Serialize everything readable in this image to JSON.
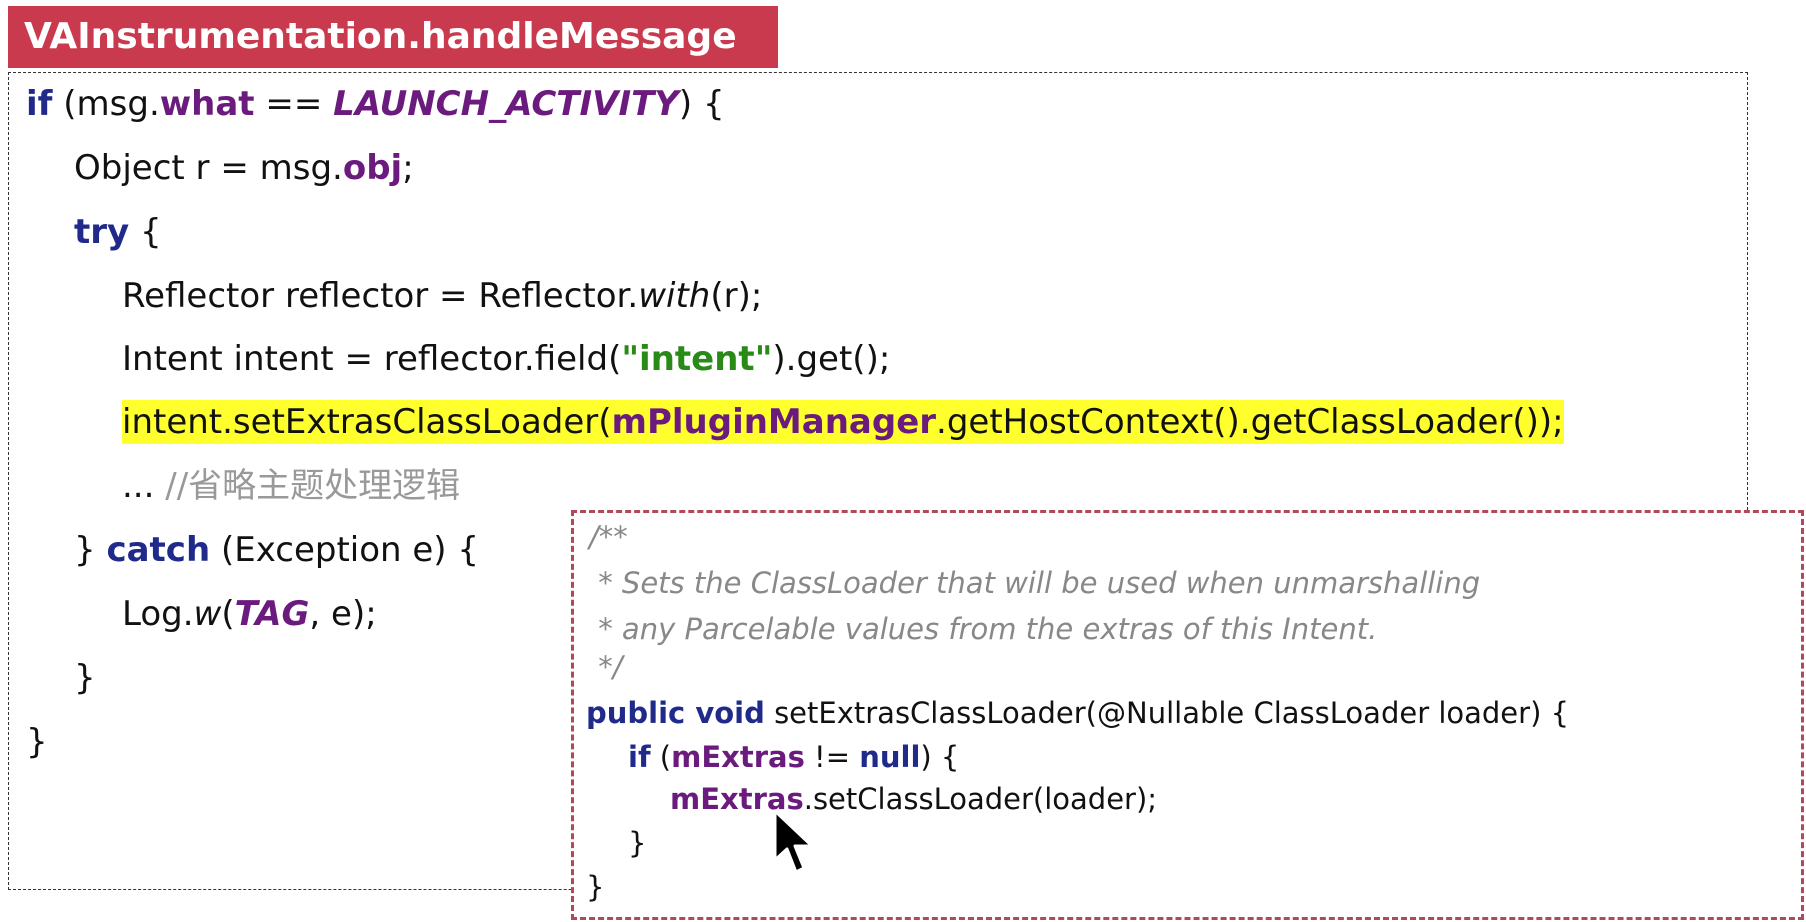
{
  "title": "VAInstrumentation.handleMessage",
  "code": {
    "l1": {
      "a": "if",
      "b": " (msg.",
      "c": "what",
      "d": " == ",
      "e": "LAUNCH_ACTIVITY",
      "f": ") {"
    },
    "l2": {
      "a": "Object r = msg.",
      "b": "obj",
      "c": ";"
    },
    "l3": {
      "a": "try",
      "b": " {"
    },
    "l4": {
      "a": "Reflector reflector = Reflector.",
      "b": "with",
      "c": "(r);"
    },
    "l5": {
      "a": "Intent intent = reflector.field(",
      "b": "\"intent\"",
      "c": ").get();"
    },
    "l6": {
      "a": "intent.setExtrasClassLoader(",
      "b": "mPluginManager",
      "c": ".getHostContext().getClassLoader());"
    },
    "l7": {
      "a": "... ",
      "b": "//省略主题处理逻辑"
    },
    "l8": {
      "a": "} ",
      "b": "catch",
      "c": " (Exception e) {"
    },
    "l9": {
      "a": "Log.",
      "b": "w",
      "c": "(",
      "d": "TAG",
      "e": ", e);"
    },
    "l10": "}",
    "l11": "}"
  },
  "popup": {
    "c1": "/**",
    "c2": " * Sets the ClassLoader that will be used when unmarshalling",
    "c3": " * any Parcelable values from the extras of this Intent.",
    "c4": " */",
    "l1": {
      "a": "public void",
      "b": " setExtrasClassLoader(@Nullable ClassLoader loader) {"
    },
    "l2": {
      "a": "if",
      "b": " (",
      "c": "mExtras",
      "d": " != ",
      "e": "null",
      "f": ") {"
    },
    "l3": {
      "a": "mExtras",
      "b": ".setClassLoader(loader);"
    },
    "l4": "}",
    "l5": "}"
  },
  "colors": {
    "title_bg": "#c93a4e",
    "keyword": "#1f2a8a",
    "field": "#6a1b7d",
    "string": "#2a8a17",
    "highlight": "#ffff2e",
    "popup_border": "#b04a5a"
  },
  "icons": {
    "cursor": "mouse-pointer-icon"
  }
}
